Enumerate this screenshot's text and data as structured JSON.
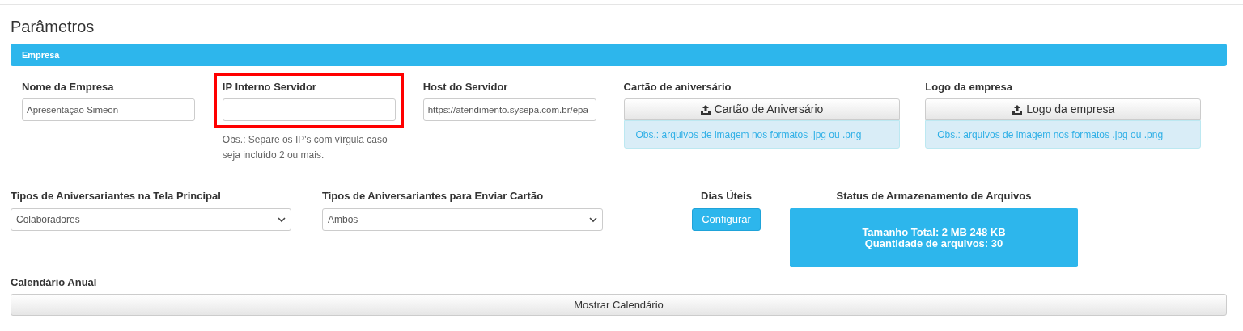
{
  "page_title": "Parâmetros",
  "section": {
    "title": "Empresa"
  },
  "fields": [
    {
      "kind": "text",
      "label": "Nome da Empresa",
      "value": "Apresentação Simeon",
      "highlighted": false
    },
    {
      "kind": "text",
      "label": "IP Interno Servidor",
      "highlighted": true,
      "note": "Obs.: Separe os IP's com vírgula caso seja incluído 2 ou mais."
    },
    {
      "kind": "text",
      "label": "Host do Servidor",
      "value": "https://atendimento.sysepa.com.br/epa",
      "highlighted": false
    },
    {
      "kind": "upload",
      "label": "Cartão de aniversário",
      "button": "Cartão de Aniversário",
      "note": "Obs.: arquivos de imagem nos formatos .jpg ou .png"
    },
    {
      "kind": "upload",
      "label": "Logo da empresa",
      "button": "Logo da empresa",
      "note": "Obs.: arquivos de imagem nos formatos .jpg ou .png"
    }
  ],
  "selects": [
    {
      "label": "Tipos de Aniversariantes na Tela Principal",
      "value": "Colaboradores"
    },
    {
      "label": "Tipos de Aniversariantes para Enviar Cartão",
      "value": "Ambos"
    }
  ],
  "business_days": {
    "label": "Dias Úteis",
    "button": "Configurar"
  },
  "storage": {
    "label": "Status de Armazenamento de Arquivos",
    "lines": [
      "Tamanho Total: 2 MB 248 KB",
      "Quantidade de arquivos: 30"
    ]
  },
  "calendar": {
    "label": "Calendário Anual",
    "button": "Mostrar Calendário"
  }
}
